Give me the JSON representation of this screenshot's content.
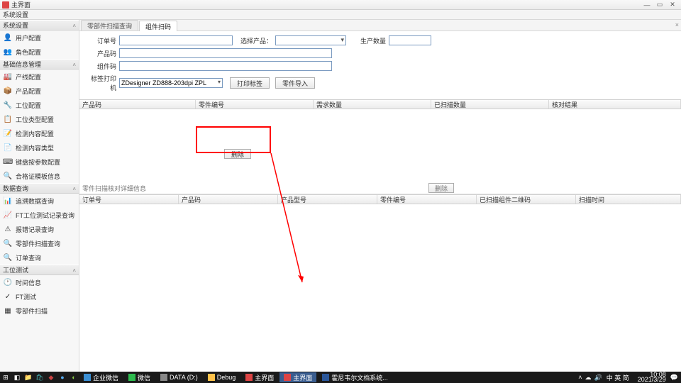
{
  "window": {
    "title": "主界面"
  },
  "menu": {
    "item0": "系统设置"
  },
  "sidebar": {
    "system": {
      "header": "系统设置",
      "items": [
        "用户配置",
        "角色配置"
      ]
    },
    "basic": {
      "header": "基础信息管理",
      "items": [
        "产线配置",
        "产品配置",
        "工位配置",
        "工位类型配置",
        "检测内容配置",
        "检测内容类型",
        "键盘按参数配置",
        "合格证模板信息"
      ]
    },
    "query": {
      "header": "数据查询",
      "items": [
        "追溯数据查询",
        "FT工位测试记录查询",
        "报错记录查询",
        "零部件扫描查询",
        "订单查询"
      ]
    },
    "test": {
      "header": "工位测试",
      "items": [
        "时间信息",
        "FT测试",
        "零部件扫描"
      ]
    }
  },
  "tabs": {
    "t0": "零部件扫描查询",
    "t1": "组件扫码"
  },
  "form": {
    "orderLabel": "订单号",
    "productLabel": "选择产品：",
    "qtyLabel": "生产数量",
    "codeLabel": "产品码",
    "partLabel": "组件码",
    "printerLabel": "标签打印机",
    "printerValue": "ZDesigner ZD888-203dpi ZPL",
    "printBtn": "打印标签",
    "importBtn": "零件导入",
    "deleteBtn": "删除",
    "deleteSmall": "删除"
  },
  "grid1": {
    "c0": "产品码",
    "c1": "零件编号",
    "c2": "需求数量",
    "c3": "已扫描数量",
    "c4": "核对结果"
  },
  "subtitle": "零件扫描核对详细信息",
  "grid2": {
    "c0": "订单号",
    "c1": "产品码",
    "c2": "产品型号",
    "c3": "零件编号",
    "c4": "已扫描组件二维码",
    "c5": "扫描时间"
  },
  "taskbar": {
    "apps": [
      "企业微信",
      "微信",
      "DATA (D:)",
      "Debug",
      "主界面",
      "主界面",
      "霍尼韦尔文档系统..."
    ],
    "ime": "中 英 简",
    "time": "10:08",
    "date": "2021/3/29"
  },
  "icons": {
    "user": "👤",
    "role": "👥",
    "line": "🏭",
    "product": "📦",
    "station": "🔧",
    "stationType": "📋",
    "inspect": "📝",
    "inspectType": "📄",
    "keyboard": "⌨",
    "cert": "🔍",
    "trace": "📊",
    "ft": "📈",
    "err": "⚠",
    "scan": "🔍",
    "order": "🔍",
    "time": "🕐",
    "fttest": "✓",
    "partscan": "▦"
  }
}
